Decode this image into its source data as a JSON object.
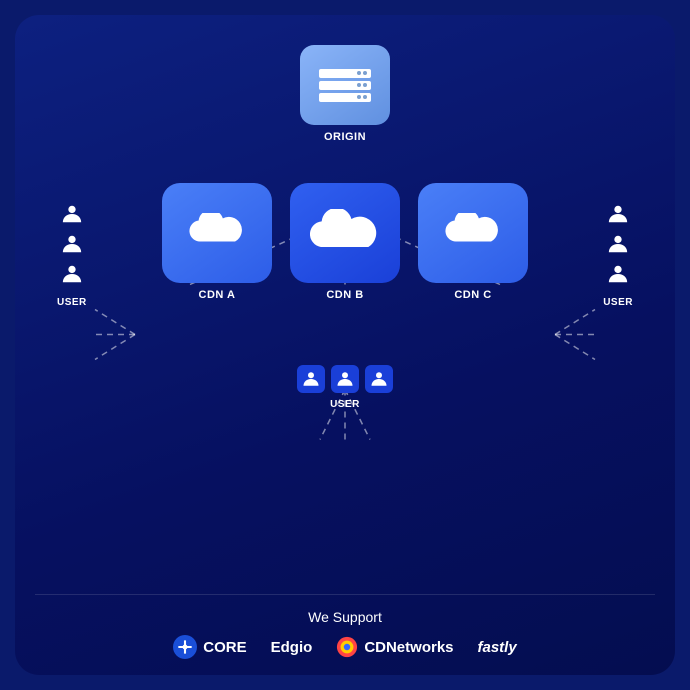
{
  "diagram": {
    "origin_label": "ORIGIN",
    "cdn_a_label": "CDN A",
    "cdn_b_label": "CDN B",
    "cdn_c_label": "CDN C",
    "user_label_left": "USER",
    "user_label_right": "USER",
    "user_label_bottom": "USER"
  },
  "supports": {
    "title": "We Support",
    "logos": [
      {
        "name": "CORE",
        "type": "core"
      },
      {
        "name": "Edgio",
        "type": "edgio"
      },
      {
        "name": "CDNetworks",
        "type": "cdnetworks"
      },
      {
        "name": "fastly",
        "type": "fastly"
      }
    ]
  }
}
